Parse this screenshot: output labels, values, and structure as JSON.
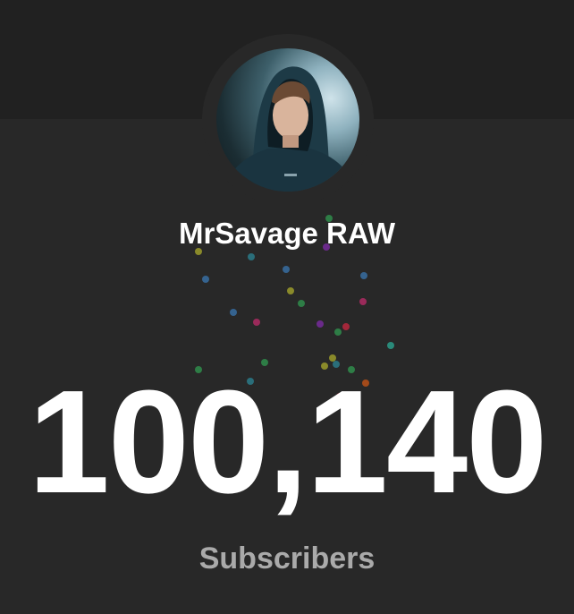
{
  "channel": {
    "name": "MrSavage RAW",
    "avatar_icon": "channel-avatar-photo"
  },
  "counter": {
    "value": "100,140",
    "label": "Subscribers"
  },
  "colors": {
    "background": "#282828",
    "top_band": "#212121",
    "text_primary": "#ffffff",
    "text_secondary": "#aaaaaa"
  }
}
